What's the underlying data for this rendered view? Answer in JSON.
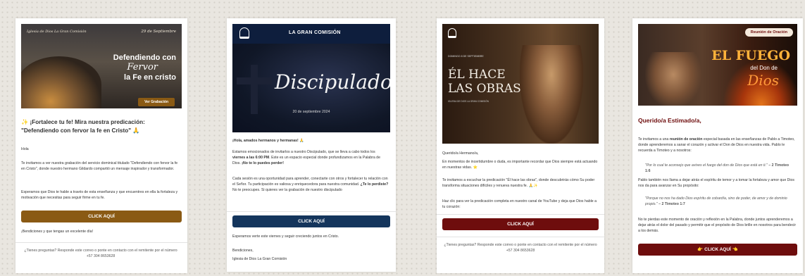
{
  "emails": [
    {
      "banner": {
        "script_left": "Iglesia de Dios La Gran Comisión",
        "date": "29 de Septiembre",
        "line1": "Defendiendo con",
        "line2": "Fervor",
        "line3": "la Fe en cristo",
        "button": "Ver Grabación"
      },
      "heading_icon": "✨",
      "heading": "¡Fortalece tu fe! Mira nuestra predicación: \"Defendiendo con fervor la fe en Cristo\" 🙏",
      "greeting": "Hola",
      "para1": "Te invitamos a ver nuestra grabación del servicio dominical titulado \"Defendiendo con fervor la fe en Cristo\", donde nuestro hermano Gildardo compartió un mensaje inspirador y transformador.",
      "para2": "Esperamos que Dios te hable a través de esta enseñanza y que encuentres en ella la fortaleza y motivación que necesitas para seguir firme en tu fe.",
      "cta": "CLICK AQUÍ",
      "closing": "¡Bendiciones y que tengas un excelente día!",
      "footer": "¿Tienes preguntas? Responde este correo o ponte en contacto con el remitente por el número +57 304 8653628"
    },
    {
      "header_title": "LA GRAN COMISIÓN",
      "banner": {
        "script": "Discipulado",
        "date": "20 de septiembre 2024"
      },
      "greeting": "¡Hola, amados hermanos y hermanas! 🙏",
      "para1_a": "Estamos emocionados de invitarlos a nuestro Discipulado, que se lleva a cabo todos los ",
      "para1_b": "viernes a las 6:00 PM",
      "para1_c": ". Este es un espacio especial donde profundizamos en la Palabra de Dios. ",
      "para1_d": "¡No te lo puedes perder!",
      "para2_a": "Cada sesión es una oportunidad para aprender, conectarte con otros y fortalecer tu relación con el Señor. Tu participación es valiosa y enriquecedora para nuestra comunidad. ",
      "para2_b": "¿Te lo perdiste?",
      "para2_c": " No te preocupes. Si quieres ver la grabación de nuestro discipulado",
      "cta": "CLICK AQUÍ",
      "after": "Esperamos verte este viernes y seguir creciendo juntos en Cristo.",
      "sign1": "Bendiciones,",
      "sign2": "Iglesia de Dios La Gran Comisión"
    },
    {
      "banner": {
        "small_top": "DOMINGO 8 DE SEPTIEMBRE",
        "line1": "ÉL HACE",
        "line2": "LAS OBRAS",
        "small_bottom": "IGLESIA DE DIOS LA GRAN COMISIÓN"
      },
      "greeting": "Querido/a Hermano/a,",
      "para1": "En momentos de incertidumbre o duda, es importante recordar que Dios siempre está actuando en nuestras vidas. ⭐",
      "para2": "Te invitamos a escuchar la predicación \"Él hace las obras\", donde descubrirás cómo Su poder transforma situaciones difíciles y renueva nuestra fe. 🙏✨",
      "para3": "Haz clic  para ver la predicación completa en nuestro canal de YouTube y deja que Dios hable a tu corazón:",
      "cta": "CLICK AQUÍ",
      "footer": "¿Tienes preguntas? Responde este correo o ponte en contacto con el remitente por el número +57 304 8653628"
    },
    {
      "banner": {
        "badge": "Reunión de Oración",
        "line1": "EL FUEGO",
        "line2": "del Don de",
        "line3": "Dios"
      },
      "heading": "Querido/a Estimado/a,",
      "para1_a": "Te invitamos a una ",
      "para1_b": "reunión de oración",
      "para1_c": " especial basada en las enseñanzas de Pablo a Timoteo, donde aprenderemos a sanar el corazón y activar el Don de Dios en nuestra vida. Pablo le recuerda a Timoteo y a nosotros:",
      "quote1": "\"Por lo cual te aconsejo que avives el fuego del don de Dios que está en ti.\"",
      "ref1": " – 2 Timoteo 1:6",
      "para2": "Pablo también nos llama a dejar atrás el espíritu de temor y a tomar la fortaleza y amor que Dios nos da para avanzar en Su propósito:",
      "quote2": "\"Porque no nos ha dado Dios espíritu de cobardía, sino de poder, de amor y de dominio propio.\"",
      "ref2": " – 2 Timoteo 1:7",
      "para3": "No te pierdas este momento de oración y reflexión en la Palabra, donde juntos aprenderemos a dejar atrás el dolor del pasado y permitir que el propósito de Dios brille en nosotros para bendecir a los demás.",
      "cta_icon": "👉",
      "cta": "CLICK AQUÍ",
      "cta_icon2": "👈"
    }
  ]
}
